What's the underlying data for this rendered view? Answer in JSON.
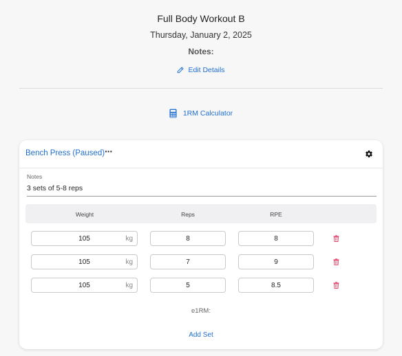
{
  "header": {
    "title": "Full Body Workout B",
    "date": "Thursday, January 2, 2025",
    "notes_heading": "Notes:",
    "edit_details_label": "Edit Details",
    "calculator_label": "1RM Calculator"
  },
  "exercise": {
    "title": "Bench Press (Paused)",
    "more_label": "···",
    "notes_label": "Notes",
    "notes_value": "3 sets of 5-8 reps",
    "columns": {
      "weight": "Weight",
      "reps": "Reps",
      "rpe": "RPE"
    },
    "sets": [
      {
        "weight": "105",
        "unit": "kg",
        "reps": "8",
        "rpe": "8"
      },
      {
        "weight": "105",
        "unit": "kg",
        "reps": "7",
        "rpe": "9"
      },
      {
        "weight": "105",
        "unit": "kg",
        "reps": "5",
        "rpe": "8.5"
      }
    ],
    "e1rm_label": "e1RM:",
    "add_set_label": "Add Set"
  },
  "colors": {
    "link": "#1f6fd1",
    "delete": "#e0446a"
  }
}
